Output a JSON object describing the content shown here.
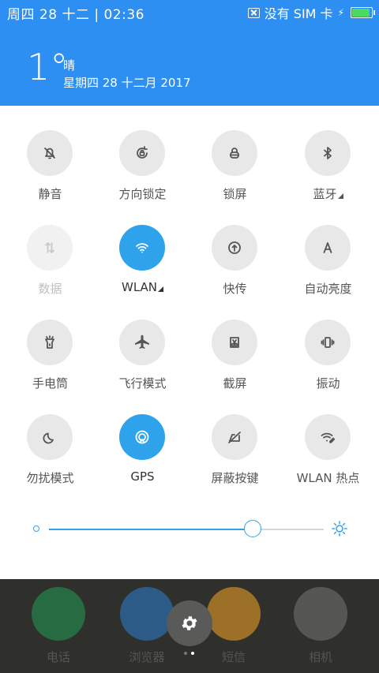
{
  "status_bar": {
    "left": "周四 28 十二 | 02:36",
    "no_sim": "没有 SIM 卡",
    "battery_level": 1.0
  },
  "weather": {
    "temperature": "1°",
    "condition": "晴",
    "date": "星期四 28 十二月 2017"
  },
  "toggles": [
    {
      "label": "静音",
      "icon": "silent-bell-icon",
      "state": "off"
    },
    {
      "label": "方向锁定",
      "icon": "rotation-lock-icon",
      "state": "off"
    },
    {
      "label": "锁屏",
      "icon": "lock-icon",
      "state": "off"
    },
    {
      "label": "蓝牙",
      "icon": "bluetooth-icon",
      "state": "off",
      "has_more": true
    },
    {
      "label": "数据",
      "icon": "mobile-data-icon",
      "state": "disabled"
    },
    {
      "label": "WLAN",
      "icon": "wifi-icon",
      "state": "on",
      "has_more": true
    },
    {
      "label": "快传",
      "icon": "quick-transfer-icon",
      "state": "off"
    },
    {
      "label": "自动亮度",
      "icon": "auto-brightness-icon",
      "state": "off"
    },
    {
      "label": "手电筒",
      "icon": "flashlight-icon",
      "state": "off"
    },
    {
      "label": "飞行模式",
      "icon": "airplane-icon",
      "state": "off"
    },
    {
      "label": "截屏",
      "icon": "screenshot-icon",
      "state": "off"
    },
    {
      "label": "振动",
      "icon": "vibrate-icon",
      "state": "off"
    },
    {
      "label": "勿扰模式",
      "icon": "moon-icon",
      "state": "off"
    },
    {
      "label": "GPS",
      "icon": "gps-icon",
      "state": "on"
    },
    {
      "label": "屏蔽按键",
      "icon": "block-keys-icon",
      "state": "off"
    },
    {
      "label": "WLAN 热点",
      "icon": "hotspot-icon",
      "state": "off"
    }
  ],
  "brightness": {
    "level": 0.74
  },
  "dock": [
    {
      "label": "电话",
      "color": "#1f9d55"
    },
    {
      "label": "浏览器",
      "color": "#2a7fd6"
    },
    {
      "label": "短信",
      "color": "#f5a623"
    },
    {
      "label": "相机",
      "color": "#777777"
    }
  ],
  "colors": {
    "accent": "#2ea3ec",
    "header": "#2d8ff2"
  }
}
